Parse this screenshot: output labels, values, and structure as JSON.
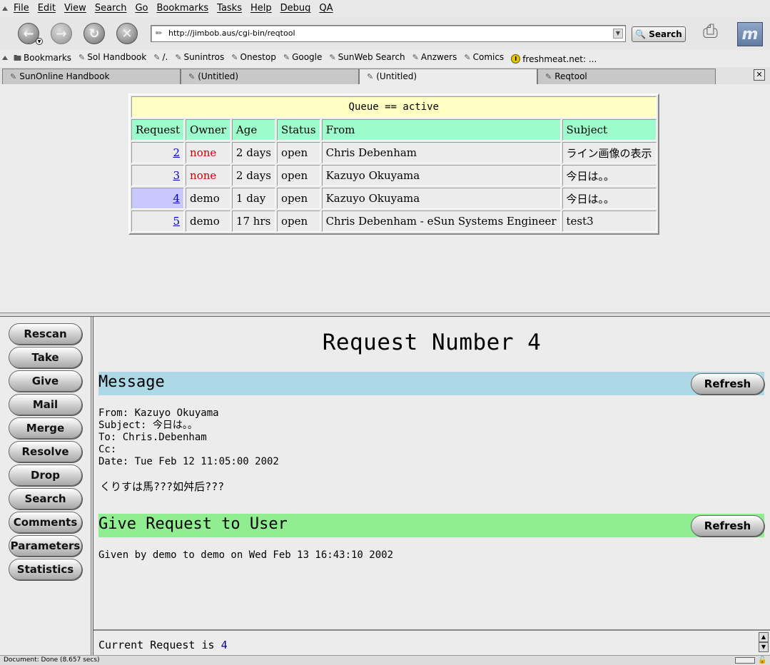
{
  "menubar": {
    "items": [
      "File",
      "Edit",
      "View",
      "Search",
      "Go",
      "Bookmarks",
      "Tasks",
      "Help",
      "Debug",
      "QA"
    ]
  },
  "navbar": {
    "url": "http://jimbob.aus/cgi-bin/reqtool",
    "search_label": "Search"
  },
  "bookmarks": {
    "items": [
      "Bookmarks",
      "Sol Handbook",
      "/.",
      "Sunintros",
      "Onestop",
      "Google",
      "SunWeb Search",
      "Anzwers",
      "Comics",
      "freshmeat.net: ..."
    ]
  },
  "tabs": [
    {
      "label": "SunOnline Handbook",
      "active": false
    },
    {
      "label": "(Untitled)",
      "active": false
    },
    {
      "label": "(Untitled)",
      "active": true
    },
    {
      "label": "Reqtool",
      "active": false
    }
  ],
  "queue": {
    "caption": "Queue == active",
    "columns": [
      "Request",
      "Owner",
      "Age",
      "Status",
      "From",
      "Subject"
    ],
    "rows": [
      {
        "request": "2",
        "owner": "none",
        "age": "2 days",
        "status": "open",
        "from": "Chris Debenham",
        "subject": "ライン画像の表示"
      },
      {
        "request": "3",
        "owner": "none",
        "age": "2 days",
        "status": "open",
        "from": "Kazuyo Okuyama",
        "subject": "今日は。。"
      },
      {
        "request": "4",
        "owner": "demo",
        "age": "1 day",
        "status": "open",
        "from": "Kazuyo Okuyama",
        "subject": "今日は。。"
      },
      {
        "request": "5",
        "owner": "demo",
        "age": "17 hrs",
        "status": "open",
        "from": "Chris Debenham - eSun Systems Engineer",
        "subject": "test3"
      }
    ],
    "selected_request": "4",
    "colors": {
      "caption_bg": "#ffffc4",
      "header_bg": "#9cfccc",
      "selected_bg": "#c8c8ff",
      "none_color": "#cc0000"
    }
  },
  "actions": [
    "Rescan",
    "Take",
    "Give",
    "Mail",
    "Merge",
    "Resolve",
    "Drop",
    "Search",
    "Comments",
    "Parameters",
    "Statistics"
  ],
  "main": {
    "title": "Request Number 4",
    "message_section": {
      "label": "Message",
      "refresh_label": "Refresh",
      "color": "#add8e6"
    },
    "message_headers": {
      "from": "From: Kazuyo Okuyama",
      "subject": "Subject: 今日は。。",
      "to": "To: Chris.Debenham",
      "cc": "Cc:",
      "date": "Date: Tue Feb 12 11:05:00 2002"
    },
    "message_body": "くりすは馬???如舛后???",
    "give_section": {
      "label": "Give Request to User",
      "refresh_label": "Refresh",
      "color": "#90ee90"
    },
    "given_line": "Given by demo to demo on Wed Feb 13 16:43:10 2002"
  },
  "bottom": {
    "current_label": "Current Request is",
    "current_number": "4"
  },
  "statusbar": {
    "message": "Document: Done (8.657 secs)"
  }
}
